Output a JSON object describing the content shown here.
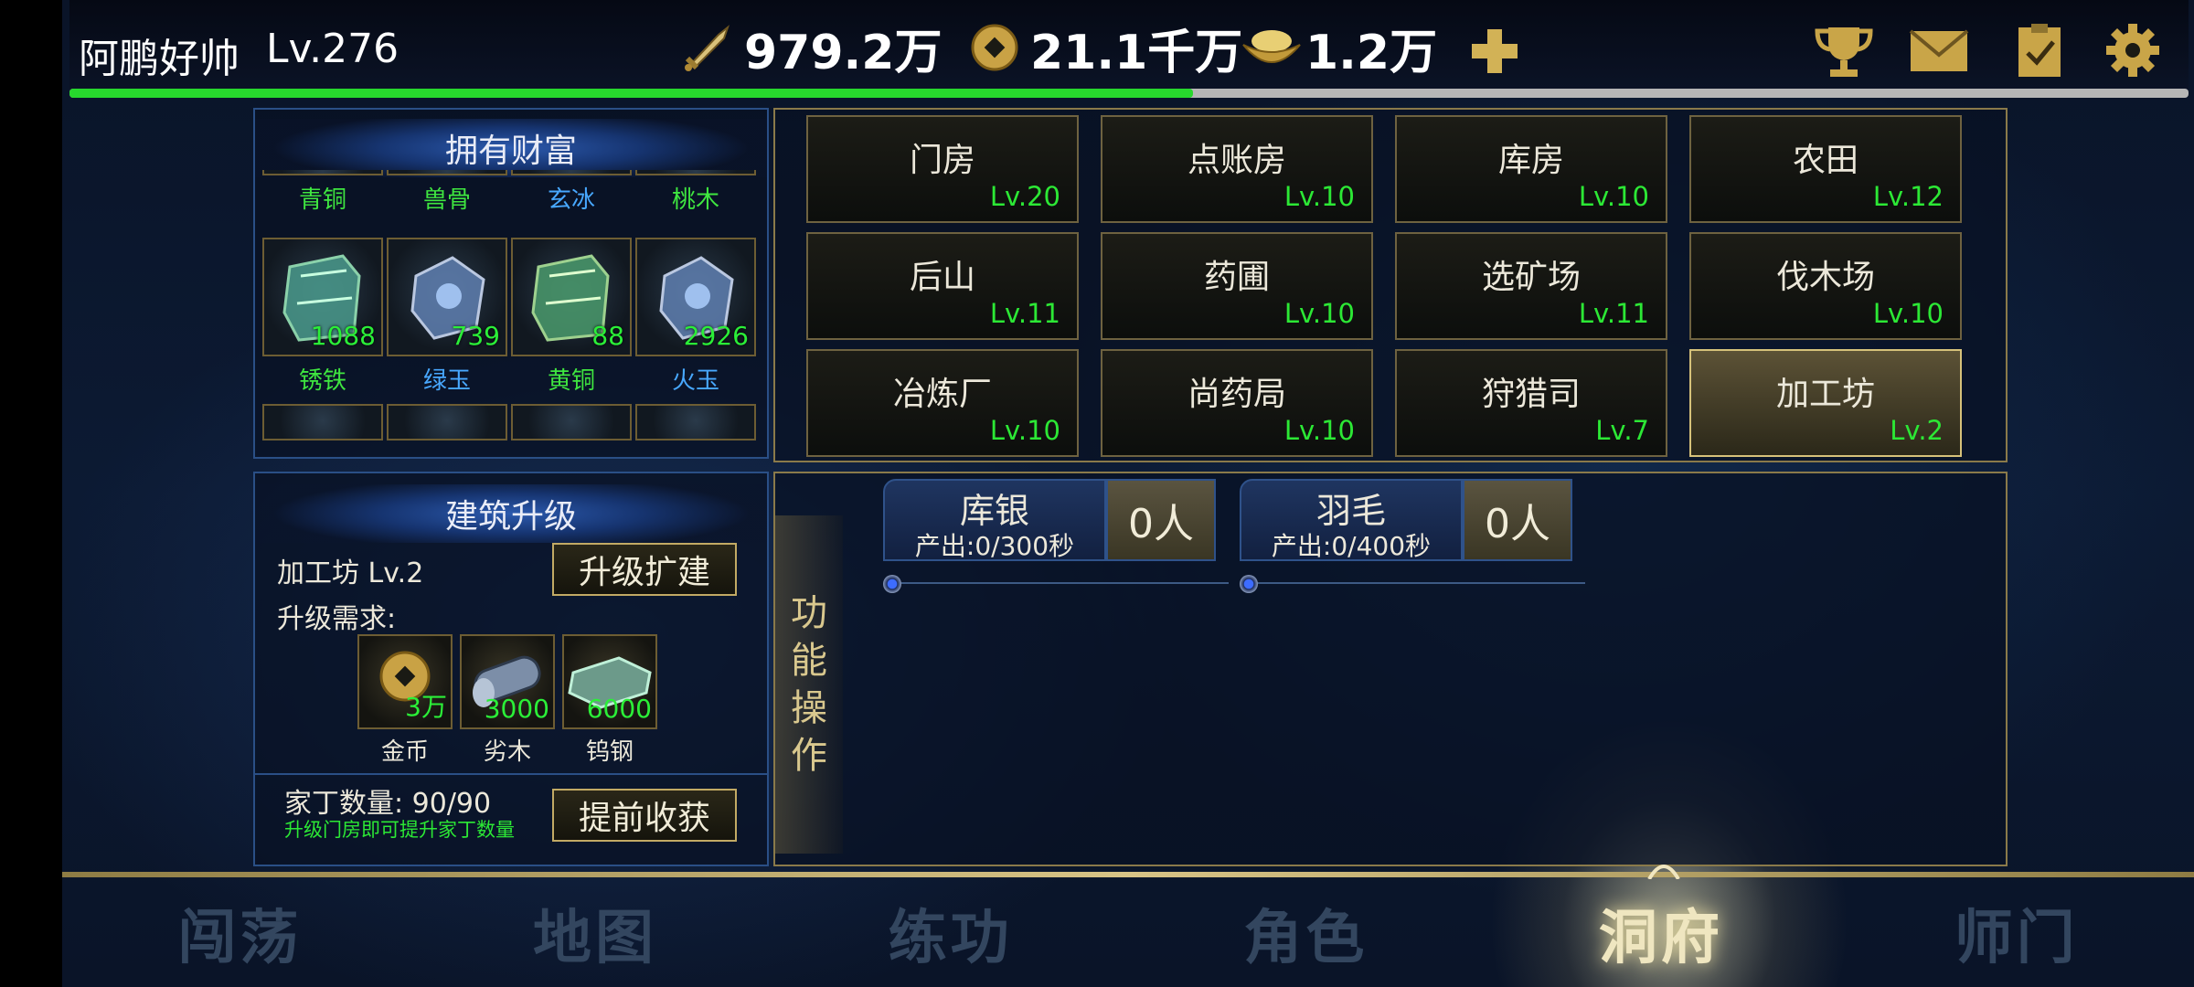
{
  "player": {
    "name": "阿鹏好帅",
    "level": "Lv.276",
    "exp_progress": 0.53
  },
  "stats": {
    "power": "979.2万",
    "coins": "21.1千万",
    "ingots": "1.2万"
  },
  "top_icons": [
    "trophy-icon",
    "mail-icon",
    "clipboard-icon",
    "gear-icon"
  ],
  "wealth": {
    "title": "拥有财富",
    "row_top_names": [
      {
        "name": "青铜",
        "color": "green"
      },
      {
        "name": "兽骨",
        "color": "green"
      },
      {
        "name": "玄冰",
        "color": "blue"
      },
      {
        "name": "桃木",
        "color": "green"
      }
    ],
    "items": [
      {
        "name": "锈铁",
        "count": "1088",
        "color": "green"
      },
      {
        "name": "绿玉",
        "count": "739",
        "color": "blue"
      },
      {
        "name": "黄铜",
        "count": "88",
        "color": "green"
      },
      {
        "name": "火玉",
        "count": "2926",
        "color": "blue"
      }
    ]
  },
  "buildings": [
    {
      "name": "门房",
      "level": "Lv.20"
    },
    {
      "name": "点账房",
      "level": "Lv.10"
    },
    {
      "name": "库房",
      "level": "Lv.10"
    },
    {
      "name": "农田",
      "level": "Lv.12"
    },
    {
      "name": "后山",
      "level": "Lv.11"
    },
    {
      "name": "药圃",
      "level": "Lv.10"
    },
    {
      "name": "选矿场",
      "level": "Lv.11"
    },
    {
      "name": "伐木场",
      "level": "Lv.10"
    },
    {
      "name": "冶炼厂",
      "level": "Lv.10"
    },
    {
      "name": "尚药局",
      "level": "Lv.10"
    },
    {
      "name": "狩猎司",
      "level": "Lv.7"
    },
    {
      "name": "加工坊",
      "level": "Lv.2"
    }
  ],
  "upgrade": {
    "title": "建筑升级",
    "building": "加工坊 Lv.2",
    "upgrade_button": "升级扩建",
    "requirements_label": "升级需求:",
    "requirements": [
      {
        "name": "金币",
        "count": "3万"
      },
      {
        "name": "劣木",
        "count": "3000"
      },
      {
        "name": "钨钢",
        "count": "6000"
      }
    ],
    "workers": "家丁数量: 90/90",
    "tip": "升级门房即可提升家丁数量",
    "harvest_button": "提前收获"
  },
  "function": {
    "tab_chars": [
      "功",
      "能",
      "操",
      "作"
    ],
    "producers": [
      {
        "title": "库银",
        "rate": "产出:0/300秒",
        "people": "0人"
      },
      {
        "title": "羽毛",
        "rate": "产出:0/400秒",
        "people": "0人"
      }
    ]
  },
  "nav": [
    "闯荡",
    "地图",
    "练功",
    "角色",
    "洞府",
    "师门"
  ],
  "colors": {
    "level_green": "#2ce835",
    "exp_green": "#27d82d",
    "gold_border": "#c2aa64",
    "panel_blue": "#2a4f86"
  }
}
